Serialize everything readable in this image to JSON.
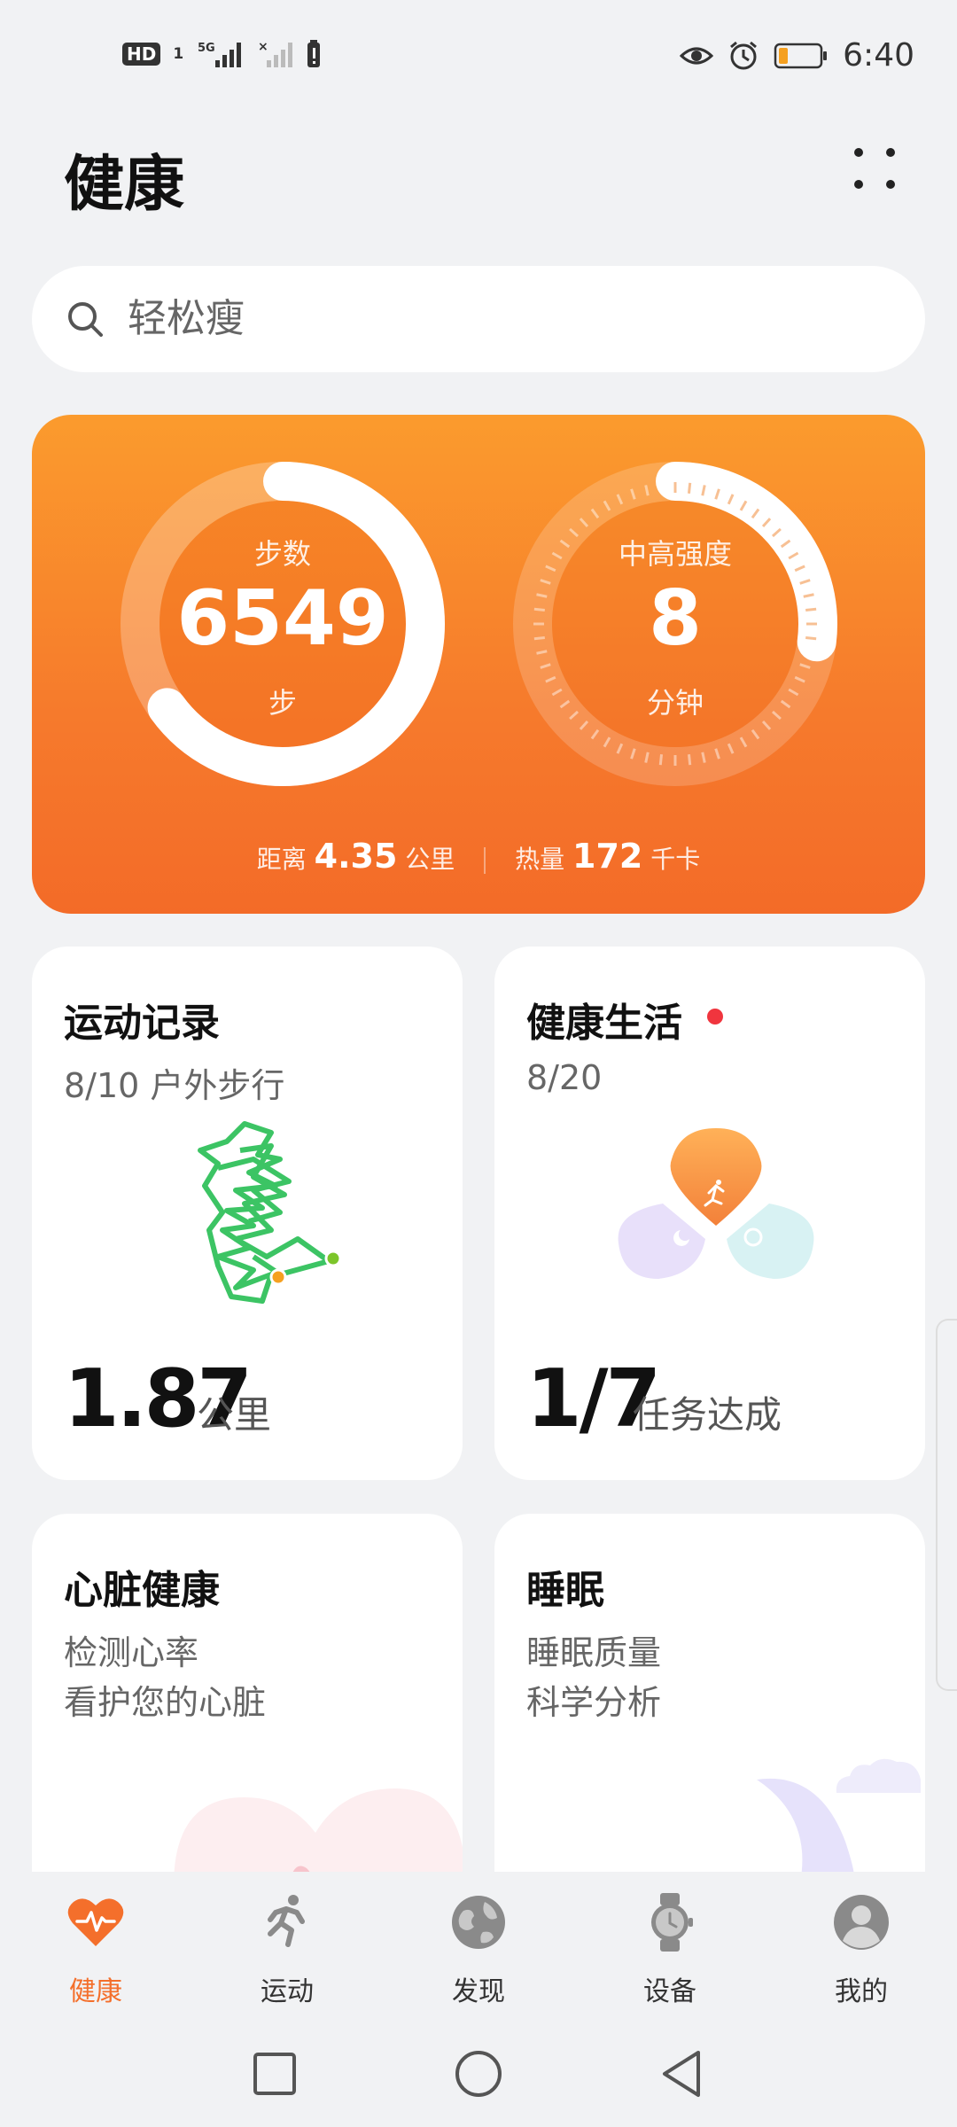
{
  "status_bar": {
    "hd_badge": "HD",
    "sim_slot": "1",
    "network": "5G",
    "time": "6:40",
    "icons": [
      "hd-icon",
      "signal-5g-icon",
      "signal-no-sim-icon",
      "alert-battery-icon",
      "eye-comfort-icon",
      "alarm-icon",
      "battery-icon"
    ]
  },
  "header": {
    "title": "健康",
    "more_icon": "grid-dots-icon"
  },
  "search": {
    "placeholder": "轻松瘦"
  },
  "activity": {
    "steps_label": "步数",
    "steps_value": "6549",
    "steps_unit": "步",
    "steps_progress": 0.65,
    "intensity_label": "中高强度",
    "intensity_value": "8",
    "intensity_unit": "分钟",
    "intensity_progress": 0.27,
    "distance_label": "距离",
    "distance_value": "4.35",
    "distance_unit": "公里",
    "calories_label": "热量",
    "calories_value": "172",
    "calories_unit": "千卡"
  },
  "tiles": {
    "workout": {
      "title": "运动记录",
      "subtitle": "8/10 户外步行",
      "value": "1.87",
      "unit": "公里"
    },
    "healthy_living": {
      "title": "健康生活",
      "subtitle": "8/20",
      "value": "1/7",
      "unit": "任务达成"
    },
    "heart": {
      "title": "心脏健康",
      "line1": "检测心率",
      "line2": "看护您的心脏"
    },
    "sleep": {
      "title": "睡眠",
      "line1": "睡眠质量",
      "line2": "科学分析"
    }
  },
  "bottom_nav": {
    "items": [
      {
        "label": "健康",
        "icon": "heart-pulse-icon",
        "active": true
      },
      {
        "label": "运动",
        "icon": "running-icon",
        "active": false
      },
      {
        "label": "发现",
        "icon": "globe-icon",
        "active": false
      },
      {
        "label": "设备",
        "icon": "watch-icon",
        "active": false
      },
      {
        "label": "我的",
        "icon": "profile-icon",
        "active": false
      }
    ]
  },
  "colors": {
    "accent": "#f46f2b",
    "card_top": "#fb9b2d",
    "card_bottom": "#f36b28",
    "route_green": "#3cc464",
    "notification_red": "#f0353e"
  }
}
